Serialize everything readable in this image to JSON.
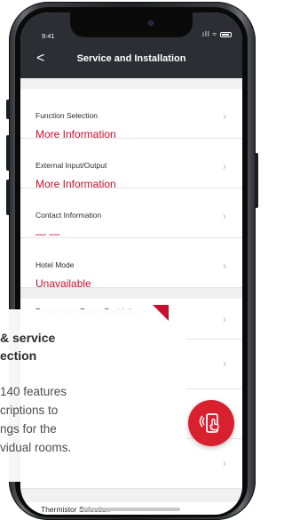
{
  "status_bar": {
    "time": "9:41",
    "signal": "ıll",
    "wifi": "≈"
  },
  "nav": {
    "back_icon": "chevron-left-icon",
    "back_glyph": "<",
    "title": "Service and Installation"
  },
  "sections": [
    {
      "rows": [
        {
          "label": "Function Selection",
          "value": "More Information"
        },
        {
          "label": "External Input/Output",
          "value": "More Information"
        },
        {
          "label": "Contact Information",
          "value": "— —"
        },
        {
          "label": "Hotel Mode",
          "value": "Unavailable"
        }
      ]
    },
    {
      "rows": [
        {
          "label": "Temperature Range Restriction"
        },
        {
          "label": ""
        },
        {
          "label": ""
        },
        {
          "label": ""
        }
      ]
    }
  ],
  "chevron": "›",
  "bottom_item": {
    "label": "Thermistor Selection"
  },
  "overlay": {
    "title_lines": [
      "& service",
      "ection"
    ],
    "body_lines": [
      "140 features",
      "criptions to",
      "ngs for the",
      "vidual rooms."
    ]
  },
  "fab": {
    "icon": "phone-touch-icon"
  },
  "colors": {
    "accent": "#c8102e",
    "header_bg": "#2b2e33"
  }
}
